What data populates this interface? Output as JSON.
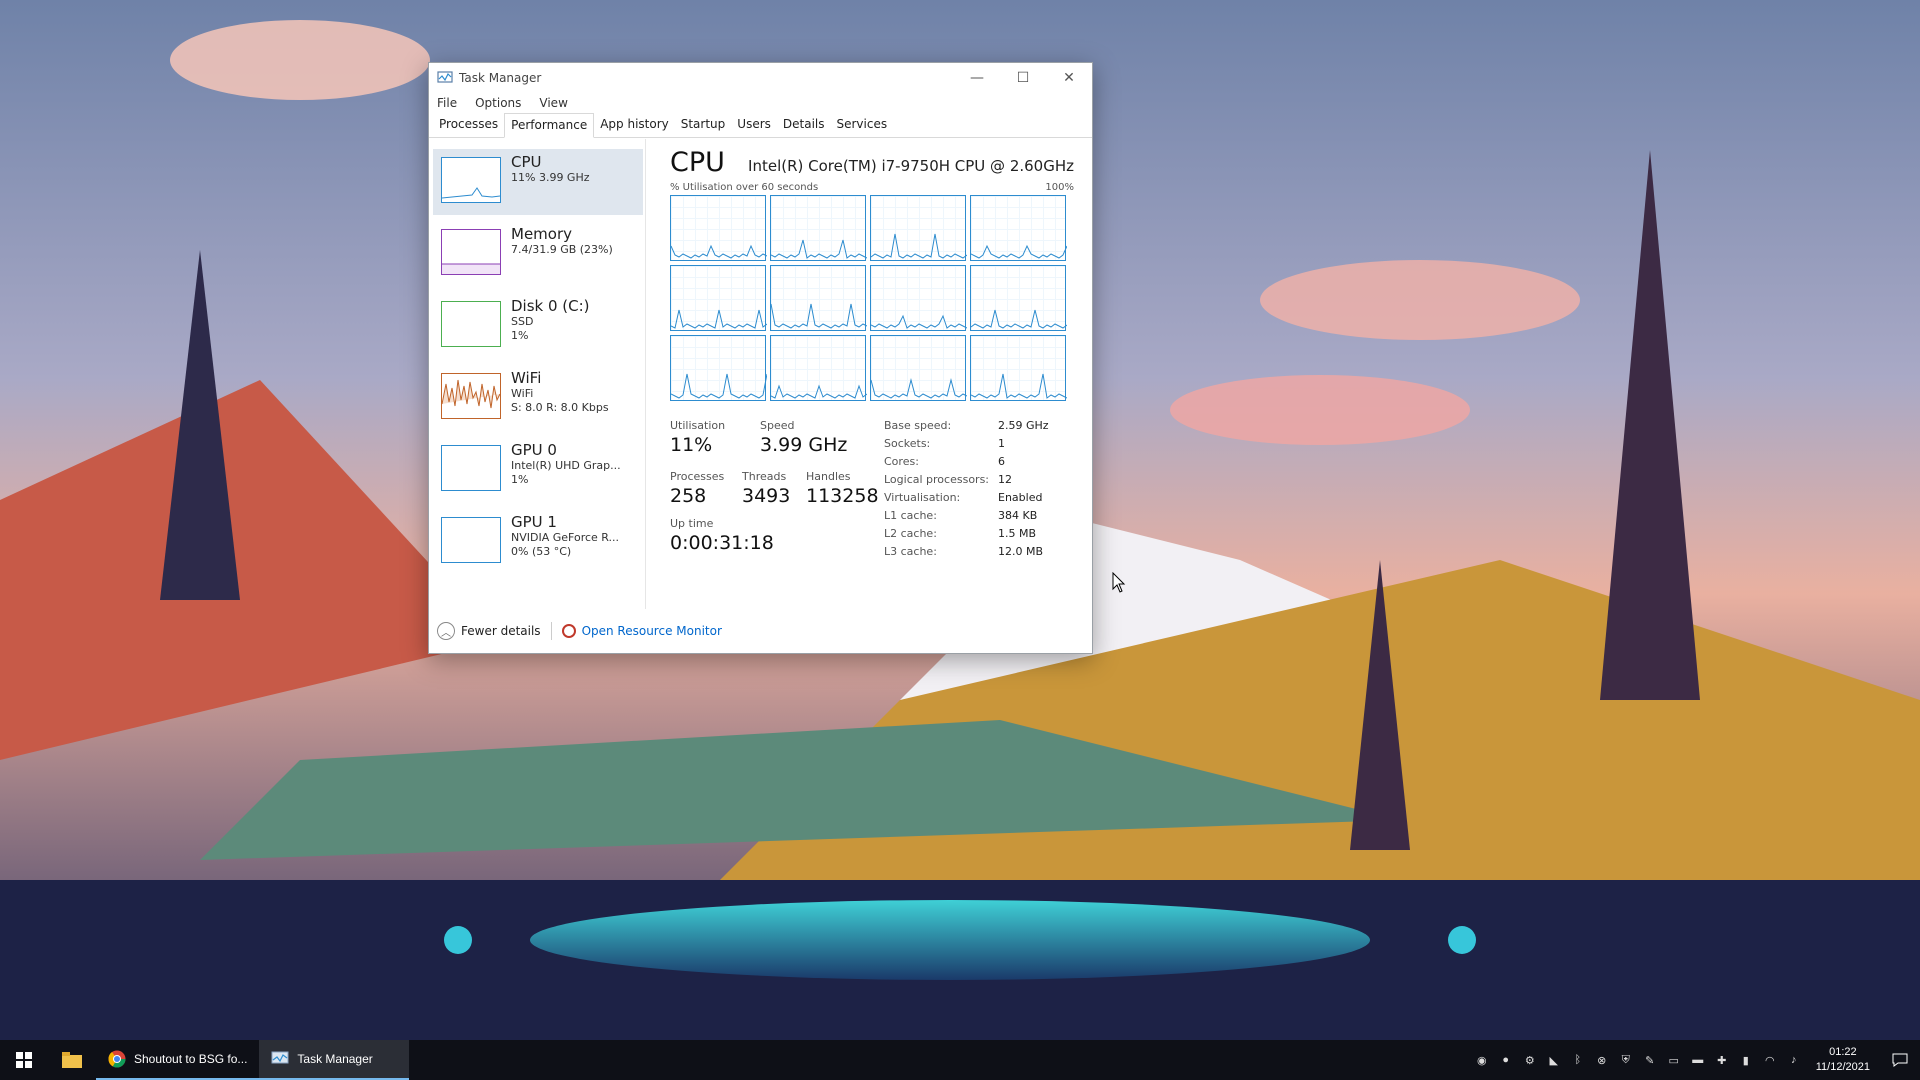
{
  "window": {
    "title": "Task Manager",
    "menu": [
      "File",
      "Options",
      "View"
    ],
    "tabs": [
      "Processes",
      "Performance",
      "App history",
      "Startup",
      "Users",
      "Details",
      "Services"
    ],
    "active_tab": "Performance"
  },
  "sidebar": {
    "items": [
      {
        "title": "CPU",
        "line1": "11% 3.99 GHz",
        "line2": "",
        "color": "#2d8ccf"
      },
      {
        "title": "Memory",
        "line1": "7.4/31.9 GB (23%)",
        "line2": "",
        "color": "#8b3fb4"
      },
      {
        "title": "Disk 0 (C:)",
        "line1": "SSD",
        "line2": "1%",
        "color": "#4caf50"
      },
      {
        "title": "WiFi",
        "line1": "WiFi",
        "line2": "S: 8.0 R: 8.0 Kbps",
        "color": "#c0642a"
      },
      {
        "title": "GPU 0",
        "line1": "Intel(R) UHD Grap...",
        "line2": "1%",
        "color": "#2d8ccf"
      },
      {
        "title": "GPU 1",
        "line1": "NVIDIA GeForce R...",
        "line2": "0% (53 °C)",
        "color": "#2d8ccf"
      }
    ]
  },
  "main": {
    "title": "CPU",
    "model": "Intel(R) Core(TM) i7-9750H CPU @ 2.60GHz",
    "graph_label": "% Utilisation over 60 seconds",
    "graph_max": "100%",
    "stats": {
      "utilisation_label": "Utilisation",
      "utilisation": "11%",
      "speed_label": "Speed",
      "speed": "3.99 GHz",
      "processes_label": "Processes",
      "processes": "258",
      "threads_label": "Threads",
      "threads": "3493",
      "handles_label": "Handles",
      "handles": "113258",
      "uptime_label": "Up time",
      "uptime": "0:00:31:18"
    },
    "specs": [
      {
        "key": "Base speed:",
        "value": "2.59 GHz"
      },
      {
        "key": "Sockets:",
        "value": "1"
      },
      {
        "key": "Cores:",
        "value": "6"
      },
      {
        "key": "Logical processors:",
        "value": "12"
      },
      {
        "key": "Virtualisation:",
        "value": "Enabled"
      },
      {
        "key": "L1 cache:",
        "value": "384 KB"
      },
      {
        "key": "L2 cache:",
        "value": "1.5 MB"
      },
      {
        "key": "L3 cache:",
        "value": "12.0 MB"
      }
    ]
  },
  "footer": {
    "fewer_details": "Fewer details",
    "open_resource_monitor": "Open Resource Monitor"
  },
  "taskbar": {
    "apps": [
      {
        "label": "Shoutout to BSG fo...",
        "icon": "chrome-icon"
      },
      {
        "label": "Task Manager",
        "icon": "task-manager-icon"
      }
    ],
    "clock_time": "01:22",
    "clock_date": "11/12/2021"
  },
  "colors": {
    "accent": "#2d8ccf",
    "link": "#0066cc"
  }
}
